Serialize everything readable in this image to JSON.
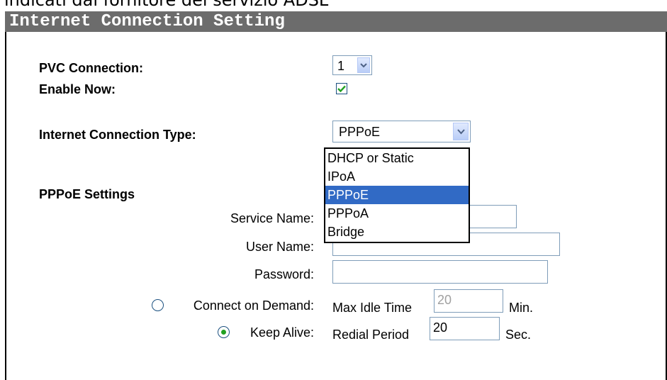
{
  "caption": "indicati dal fornitore del servizio ADSL",
  "section_title": "Internet Connection Setting",
  "pvc": {
    "label": "PVC Connection:",
    "value": "1"
  },
  "enable_now": {
    "label": "Enable Now:",
    "checked": true
  },
  "connection_type": {
    "label": "Internet Connection Type:",
    "value": "PPPoE",
    "options": [
      "DHCP or Static",
      "IPoA",
      "PPPoE",
      "PPPoA",
      "Bridge"
    ],
    "highlighted": "PPPoE"
  },
  "pppoe": {
    "heading": "PPPoE Settings",
    "service_name": {
      "label": "Service Name:",
      "value": ""
    },
    "user_name": {
      "label": "User Name:",
      "value": ""
    },
    "password": {
      "label": "Password:",
      "value": ""
    },
    "connect_on_demand": {
      "label": "Connect on Demand:",
      "selected": false,
      "field_label": "Max Idle Time",
      "value": "20",
      "unit": "Min."
    },
    "keep_alive": {
      "label": "Keep Alive:",
      "selected": true,
      "field_label": "Redial Period",
      "value": "20",
      "unit": "Sec."
    }
  },
  "icons": {
    "dropdown_arrow": "chevron-down-icon",
    "checkmark": "check-icon"
  },
  "colors": {
    "title_bar": "#6c6c6c",
    "selection": "#316ac5",
    "check": "#21a121"
  }
}
